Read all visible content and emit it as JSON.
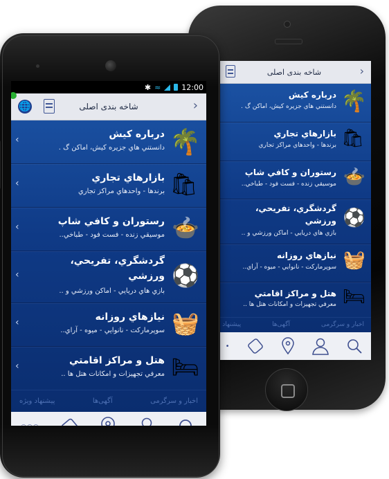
{
  "status": {
    "time": "12:00"
  },
  "nav": {
    "title": "شاخه بندی اصلی",
    "back_icon": "chevron-left-icon",
    "doc_icon": "document-icon",
    "globe_icon": "globe-icon"
  },
  "categories": [
    {
      "title": "درباره کيش",
      "subtitle": "دانستني هاي جزيره کيش، اماکن گ  .",
      "subtitle_short": "دانستني هاي جزيره کيش، اماکن گ .",
      "icon": "palm-tree-icon"
    },
    {
      "title": "بازارهاي تجاري",
      "subtitle": "برندها - واحدهاي مراکز تجاري",
      "subtitle_short": "برندها - واحدهاي مراکز تجاري",
      "icon": "shopping-bag-icon"
    },
    {
      "title": "رستوران و کافي شاپ",
      "subtitle": "موسيقي زنده - فست فود - طباخي..",
      "subtitle_short": "موسيقي زنده - فست فود - طباخي..",
      "icon": "dish-icon"
    },
    {
      "title": "گردشگري، تفريحي، ورزشي",
      "title_line1": "گردشگري، تفريحي،",
      "title_line2": "ورزشي",
      "subtitle": "بازي هاي دريايي - اماکن ورزشي و ..",
      "subtitle_short": "بازي هاي دريايي - اماکن ورزشي و ..",
      "icon": "sports-ball-icon"
    },
    {
      "title": "نيازهاي روزانه",
      "subtitle": "سوپرمارکت - نانوايي - ميوه - آراي..",
      "subtitle_short": "سوپرمارکت - نانوايي - ميوه - آراي..",
      "icon": "basket-icon"
    },
    {
      "title": "هتل و مراکز اقامتي",
      "subtitle": "معرفي تجهيزات و امکانات هتل ها ..",
      "subtitle_short": "معرفي تجهيزات و امکانات هتل ها ..",
      "icon": "bed-icon"
    }
  ],
  "bottom_tabs": {
    "news": "اخبار و سرگرمی",
    "ads": "آگهی‌ها",
    "special": "پیشنهاد ویژه",
    "special_short": "پیشنهاد و"
  },
  "toolbar": {
    "more": "○○○",
    "items": [
      "search-icon",
      "user-icon",
      "location-pin-icon",
      "ticket-icon",
      "more-dots-icon"
    ]
  }
}
